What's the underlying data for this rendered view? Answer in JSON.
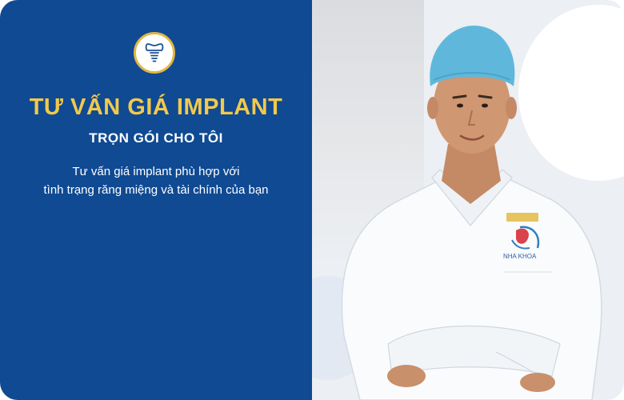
{
  "banner": {
    "icon": "dental-implant-icon",
    "title": "TƯ VẤN GIÁ IMPLANT",
    "subtitle": "TRỌN GÓI CHO TÔI",
    "description_line1": "Tư vấn giá implant phù hợp với",
    "description_line2": "tình trạng răng miệng và tài chính của bạn",
    "uniform_logo_text": "NHA KHOA",
    "colors": {
      "panel_blue": "#0f4a93",
      "title_gold": "#f2c94c",
      "badge_ring": "#e1b742",
      "cap_blue": "#5fb8dc"
    }
  }
}
